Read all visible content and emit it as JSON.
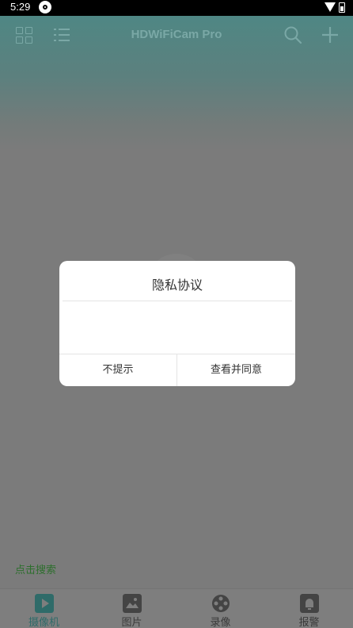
{
  "status_bar": {
    "time": "5:29"
  },
  "app": {
    "title": "HDWiFiCam Pro"
  },
  "empty_state": {
    "search_link": "点击搜索"
  },
  "bottom_nav": {
    "items": [
      {
        "label": "摄像机",
        "icon": "camera-play-icon",
        "active": true
      },
      {
        "label": "图片",
        "icon": "picture-icon",
        "active": false
      },
      {
        "label": "录像",
        "icon": "video-reel-icon",
        "active": false
      },
      {
        "label": "报警",
        "icon": "alarm-bell-icon",
        "active": false
      }
    ]
  },
  "dialog": {
    "title": "隐私协议",
    "buttons": {
      "dismiss": "不提示",
      "agree": "查看并同意"
    }
  },
  "colors": {
    "accent": "#2f6b69",
    "header": "#4f8784",
    "overlay": "#7b7b7b"
  }
}
